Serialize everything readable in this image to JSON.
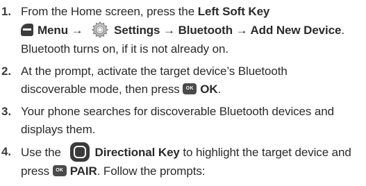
{
  "steps": [
    {
      "number": "1.",
      "line1_pre": "From the Home screen, press the ",
      "line1_bold": "Left Soft Key",
      "menu_bold": "Menu",
      "arrow1": " → ",
      "settings_bold": "Settings",
      "arrow2": " → ",
      "bluetooth_bold": "Bluetooth",
      "arrow3": " → ",
      "add_bold": "Add New Device",
      "line2_end": ".",
      "line3": "Bluetooth turns on, if it is not already on.",
      "icons": [
        "left-soft-key-icon",
        "settings-gear-icon"
      ]
    },
    {
      "number": "2.",
      "line1": "At the prompt, activate the target device’s Bluetooth",
      "line2_pre": "discoverable mode, then press ",
      "ok_icon_text": "OK",
      "ok_bold": "OK",
      "line2_end": ".",
      "icons": [
        "ok-key-icon"
      ]
    },
    {
      "number": "3.",
      "line1": "Your phone searches for discoverable Bluetooth devices and",
      "line2": "displays them."
    },
    {
      "number": "4.",
      "line1_pre": "Use the ",
      "dir_bold": "Directional Key",
      "line1_post": " to highlight the target device and",
      "line2_pre": "press ",
      "ok_icon_text": "OK",
      "pair_bold": "PAIR",
      "line2_post": ". Follow the prompts:",
      "icons": [
        "directional-key-icon",
        "ok-key-icon"
      ]
    }
  ]
}
